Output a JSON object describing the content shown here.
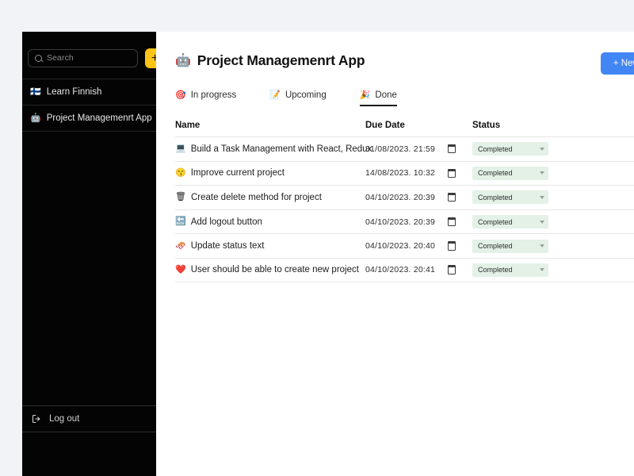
{
  "sidebar": {
    "search": {
      "placeholder": "Search",
      "value": "",
      "icon": "search-icon"
    },
    "add_button_label": "+",
    "items": [
      {
        "emoji": "🇫🇮",
        "label": "Learn Finnish",
        "icon": "flag-finland-icon"
      },
      {
        "emoji": "🤖",
        "label": "Project Managemenrt App",
        "icon": "robot-icon"
      }
    ],
    "logout": {
      "label": "Log out",
      "icon": "logout-icon"
    }
  },
  "header": {
    "title_emoji": "🤖",
    "title": "Project Managemenrt App",
    "new_task_label": "+ New task"
  },
  "tabs": [
    {
      "emoji": "🎯",
      "label": "In progress",
      "active": false
    },
    {
      "emoji": "📝",
      "label": "Upcoming",
      "active": false
    },
    {
      "emoji": "🎉",
      "label": "Done",
      "active": true
    }
  ],
  "table": {
    "columns": [
      "Name",
      "Due Date",
      "Status"
    ],
    "rows": [
      {
        "emoji": "💻",
        "name": "Build a Task Management with React, Redux",
        "due_date": "31/08/2023. 21:59",
        "status": "Completed"
      },
      {
        "emoji": "😙",
        "name": "Improve current project",
        "due_date": "14/08/2023. 10:32",
        "status": "Completed"
      },
      {
        "emoji": "🗑",
        "name": "Create delete method for project",
        "due_date": "04/10/2023. 20:39",
        "status": "Completed"
      },
      {
        "emoji": "🔙",
        "name": "Add logout button",
        "due_date": "04/10/2023. 20:39",
        "status": "Completed"
      },
      {
        "emoji": "🛷",
        "name": "Update status text",
        "due_date": "04/10/2023. 20:40",
        "status": "Completed"
      },
      {
        "emoji": "❤️",
        "name": "User should be able to create new project",
        "due_date": "04/10/2023. 20:41",
        "status": "Completed"
      }
    ]
  },
  "colors": {
    "page_background": "#f2f3f7",
    "sidebar_background": "#040404",
    "accent_yellow": "#fcc415",
    "accent_blue": "#4285f4",
    "status_background": "#e3f1e6"
  }
}
